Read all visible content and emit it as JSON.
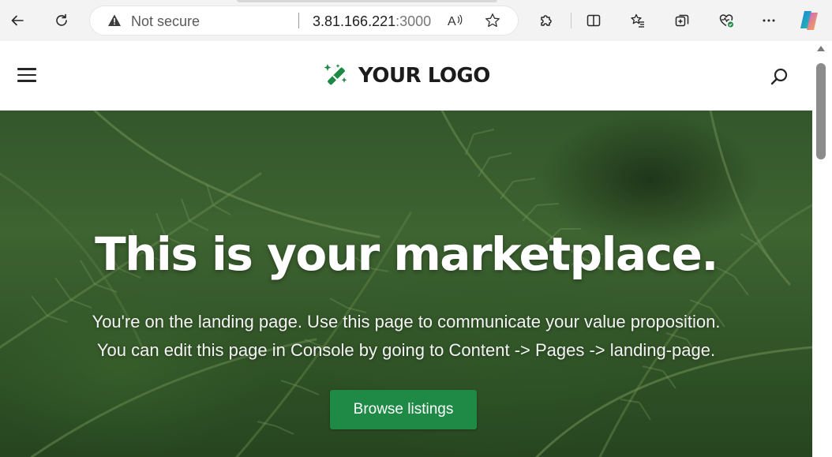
{
  "browser": {
    "security_label": "Not secure",
    "url_host": "3.81.166.221",
    "url_port": ":3000"
  },
  "site": {
    "logo_text": "YOUR LOGO",
    "brand_color": "#1e8a45"
  },
  "hero": {
    "title": "This is your marketplace.",
    "subtitle_line1": "You're on the landing page. Use this page to communicate your value proposition.",
    "subtitle_line2": "You can edit this page in Console by going to Content -> Pages -> landing-page.",
    "cta_label": "Browse listings"
  },
  "icons": {
    "back": "back-arrow-icon",
    "refresh": "refresh-icon",
    "warning": "warning-icon",
    "read_aloud": "read-aloud-icon",
    "favorite": "star-icon",
    "extensions": "puzzle-icon",
    "split": "split-screen-icon",
    "favorites_list": "favorites-icon",
    "collections": "collections-icon",
    "performance": "heartbeat-icon",
    "more": "more-icon",
    "copilot": "copilot-icon",
    "menu": "hamburger-menu-icon",
    "search": "search-icon"
  }
}
